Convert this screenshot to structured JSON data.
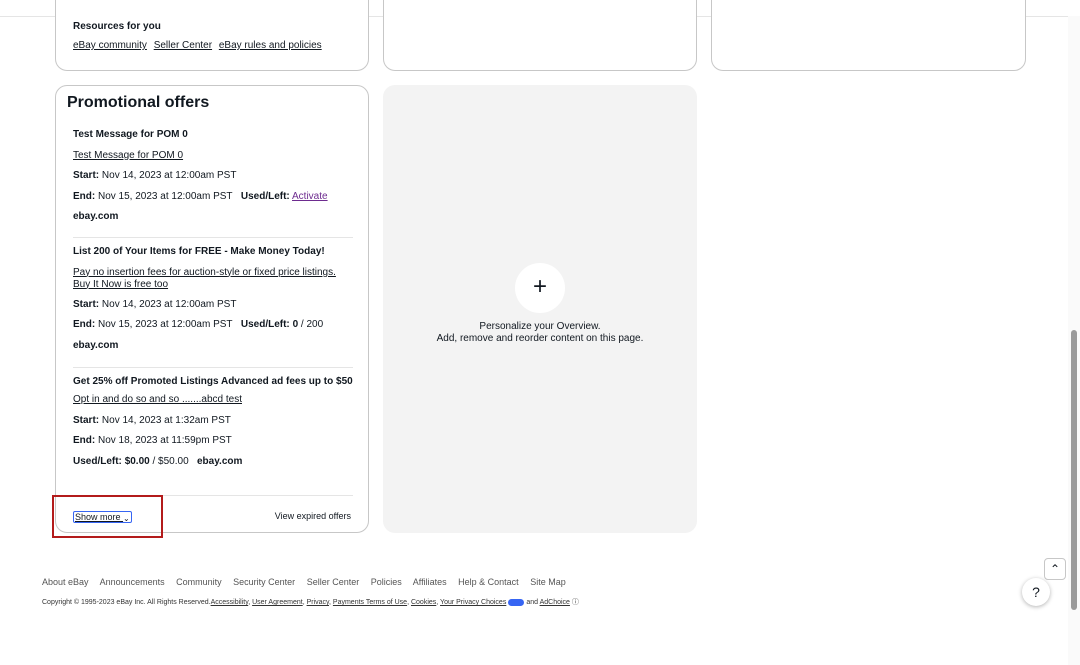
{
  "resources": {
    "title": "Resources for you",
    "links": [
      "eBay community",
      "Seller Center",
      "eBay rules and policies"
    ]
  },
  "promotional_offers": {
    "title": "Promotional offers",
    "offers": [
      {
        "headline": "Test Message for POM 0",
        "link": "Test Message for POM 0",
        "start_label": "Start:",
        "start": "Nov 14, 2023 at 12:00am PST",
        "end_label": "End:",
        "end": "Nov 15, 2023 at 12:00am PST",
        "used_left_label": "Used/Left:",
        "used_left": "Activate",
        "site": "ebay.com"
      },
      {
        "headline": "List 200 of Your Items for FREE - Make Money Today!",
        "link": "Pay no insertion fees for auction-style or fixed price listings. Buy It Now is free too",
        "start_label": "Start:",
        "start": "Nov 14, 2023 at 12:00am PST",
        "end_label": "End:",
        "end": "Nov 15, 2023 at 12:00am PST",
        "used_left_label": "Used/Left:",
        "used_value": "0",
        "used_total": "/ 200",
        "site": "ebay.com"
      },
      {
        "headline": "Get 25% off Promoted Listings Advanced ad fees up to $50",
        "link": "Opt in and do so and so .......abcd test",
        "start_label": "Start:",
        "start": "Nov 14, 2023 at 1:32am PST",
        "end_label": "End:",
        "end": "Nov 18, 2023 at 11:59pm PST",
        "used_left_label": "Used/Left:",
        "used_value": "$0.00",
        "used_total": "/ $50.00",
        "site": "ebay.com"
      }
    ],
    "show_more": "Show more",
    "view_expired": "View expired offers"
  },
  "personalize": {
    "plus": "+",
    "line1": "Personalize your Overview.",
    "line2": "Add, remove and reorder content on this page."
  },
  "footer": {
    "links": [
      "About eBay",
      "Announcements",
      "Community",
      "Security Center",
      "Seller Center",
      "Policies",
      "Affiliates",
      "Help & Contact",
      "Site Map"
    ],
    "copyright": "Copyright © 1995-2023 eBay Inc. All Rights Reserved.",
    "legal_links": [
      "Accessibility",
      "User Agreement",
      "Privacy",
      "Payments Terms of Use",
      "Cookies",
      "Your Privacy Choices"
    ],
    "and": "and",
    "adchoice": "AdChoice"
  },
  "widgets": {
    "help": "?",
    "scroll_top": "^"
  },
  "colors": {
    "highlight": "#b31b1b",
    "activate_link": "#6d2b8f",
    "focus_ring": "#3665f3"
  }
}
